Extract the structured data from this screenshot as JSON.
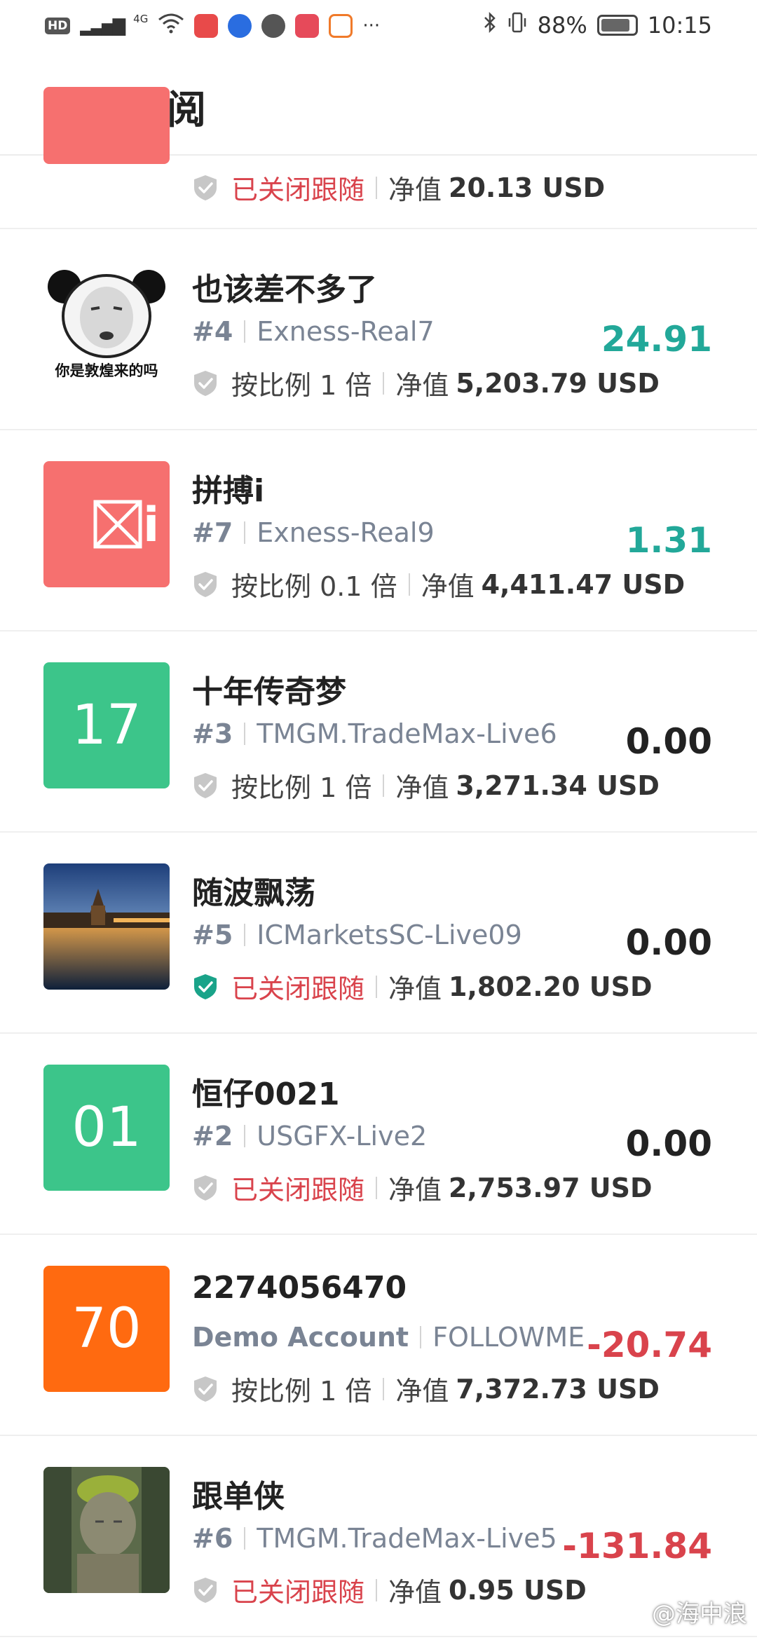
{
  "status_bar": {
    "hd": "HD",
    "network": "4G",
    "more": "···",
    "battery_percent": "88%",
    "time": "10:15"
  },
  "header": {
    "title": "订阅"
  },
  "colors": {
    "accent_back": "#f07a4a",
    "positive": "#22a899",
    "negative": "#d9434c",
    "status_closed": "#d9434c",
    "shield_active": "#1aa389",
    "shield_inactive": "#c7c7c7"
  },
  "items": [
    {
      "name": "",
      "avatar_text": "",
      "avatar_color": "#f6706f",
      "rank": "",
      "server": "",
      "status": "已关闭跟随",
      "status_type": "closed",
      "equity_label": "净值",
      "equity": "20.13 USD",
      "pnl": ""
    },
    {
      "name": "也该差不多了",
      "avatar_text": "你是敦煌来的吗",
      "avatar_type": "meme",
      "rank": "#4",
      "server": "Exness-Real7",
      "status": "按比例 1 倍",
      "status_type": "ratio",
      "equity_label": "净值",
      "equity": "5,203.79 USD",
      "pnl": "24.91",
      "pnl_sign": "pos"
    },
    {
      "name": "拼搏i",
      "avatar_text": "i",
      "avatar_type": "broken-image",
      "avatar_color": "#f6706f",
      "rank": "#7",
      "server": "Exness-Real9",
      "status": "按比例 0.1 倍",
      "status_type": "ratio",
      "equity_label": "净值",
      "equity": "4,411.47 USD",
      "pnl": "1.31",
      "pnl_sign": "pos"
    },
    {
      "name": "十年传奇梦",
      "avatar_text": "17",
      "avatar_color": "#3cc58a",
      "rank": "#3",
      "server": "TMGM.TradeMax-Live6",
      "status": "按比例 1 倍",
      "status_type": "ratio",
      "equity_label": "净值",
      "equity": "3,271.34 USD",
      "pnl": "0.00",
      "pnl_sign": "zero"
    },
    {
      "name": "随波飘荡",
      "avatar_text": "",
      "avatar_type": "photo-lake",
      "rank": "#5",
      "server": "ICMarketsSC-Live09",
      "status": "已关闭跟随",
      "status_type": "closed",
      "shield_active": true,
      "equity_label": "净值",
      "equity": "1,802.20 USD",
      "pnl": "0.00",
      "pnl_sign": "zero"
    },
    {
      "name": "恒仔0021",
      "avatar_text": "01",
      "avatar_color": "#3cc58a",
      "rank": "#2",
      "server": "USGFX-Live2",
      "status": "已关闭跟随",
      "status_type": "closed",
      "equity_label": "净值",
      "equity": "2,753.97 USD",
      "pnl": "0.00",
      "pnl_sign": "zero"
    },
    {
      "name": "2274056470",
      "avatar_text": "70",
      "avatar_color": "#ff6a10",
      "rank": "Demo Account",
      "server": "FOLLOWME",
      "status": "按比例 1 倍",
      "status_type": "ratio",
      "equity_label": "净值",
      "equity": "7,372.73 USD",
      "pnl": "-20.74",
      "pnl_sign": "neg"
    },
    {
      "name": "跟单侠",
      "avatar_text": "",
      "avatar_type": "photo-statue",
      "rank": "#6",
      "server": "TMGM.TradeMax-Live5",
      "status": "已关闭跟随",
      "status_type": "closed",
      "equity_label": "净值",
      "equity": "0.95 USD",
      "pnl": "-131.84",
      "pnl_sign": "neg"
    }
  ],
  "watermark": "@海中浪"
}
